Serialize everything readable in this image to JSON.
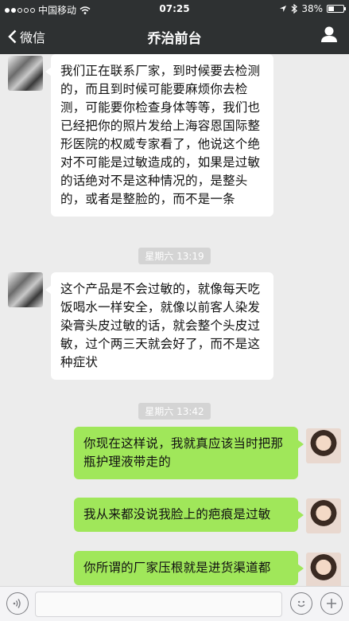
{
  "status_bar": {
    "carrier": "中国移动",
    "time": "07:25",
    "battery": "38%",
    "battery_level": 0.38
  },
  "nav": {
    "back_label": "微信",
    "title": "乔治前台"
  },
  "messages": [
    {
      "side": "in",
      "text": "我们正在联系厂家，到时候要去检测的，而且到时候可能要麻烦你去检测，可能要你检查身体等等，我们也已经把你的照片发给上海容恩国际整形医院的权威专家看了，他说这个绝对不可能是过敏造成的，如果是过敏的话绝对不是这种情况的，是整头的，或者是整脸的，而不是一条"
    },
    {
      "timestamp": "星期六 13:19"
    },
    {
      "side": "in",
      "text": "这个产品是不会过敏的，就像每天吃饭喝水一样安全，就像以前客人染发染膏头皮过敏的话，就会整个头皮过敏，过个两三天就会好了，而不是这种症状"
    },
    {
      "timestamp": "星期六 13:42"
    },
    {
      "side": "out",
      "text": "你现在这样说，我就真应该当时把那瓶护理液带走的"
    },
    {
      "side": "out",
      "text": "我从来都没说我脸上的疤痕是过敏"
    },
    {
      "side": "out",
      "text": "你所谓的厂家压根就是进货渠道都"
    }
  ],
  "input": {
    "placeholder": ""
  }
}
